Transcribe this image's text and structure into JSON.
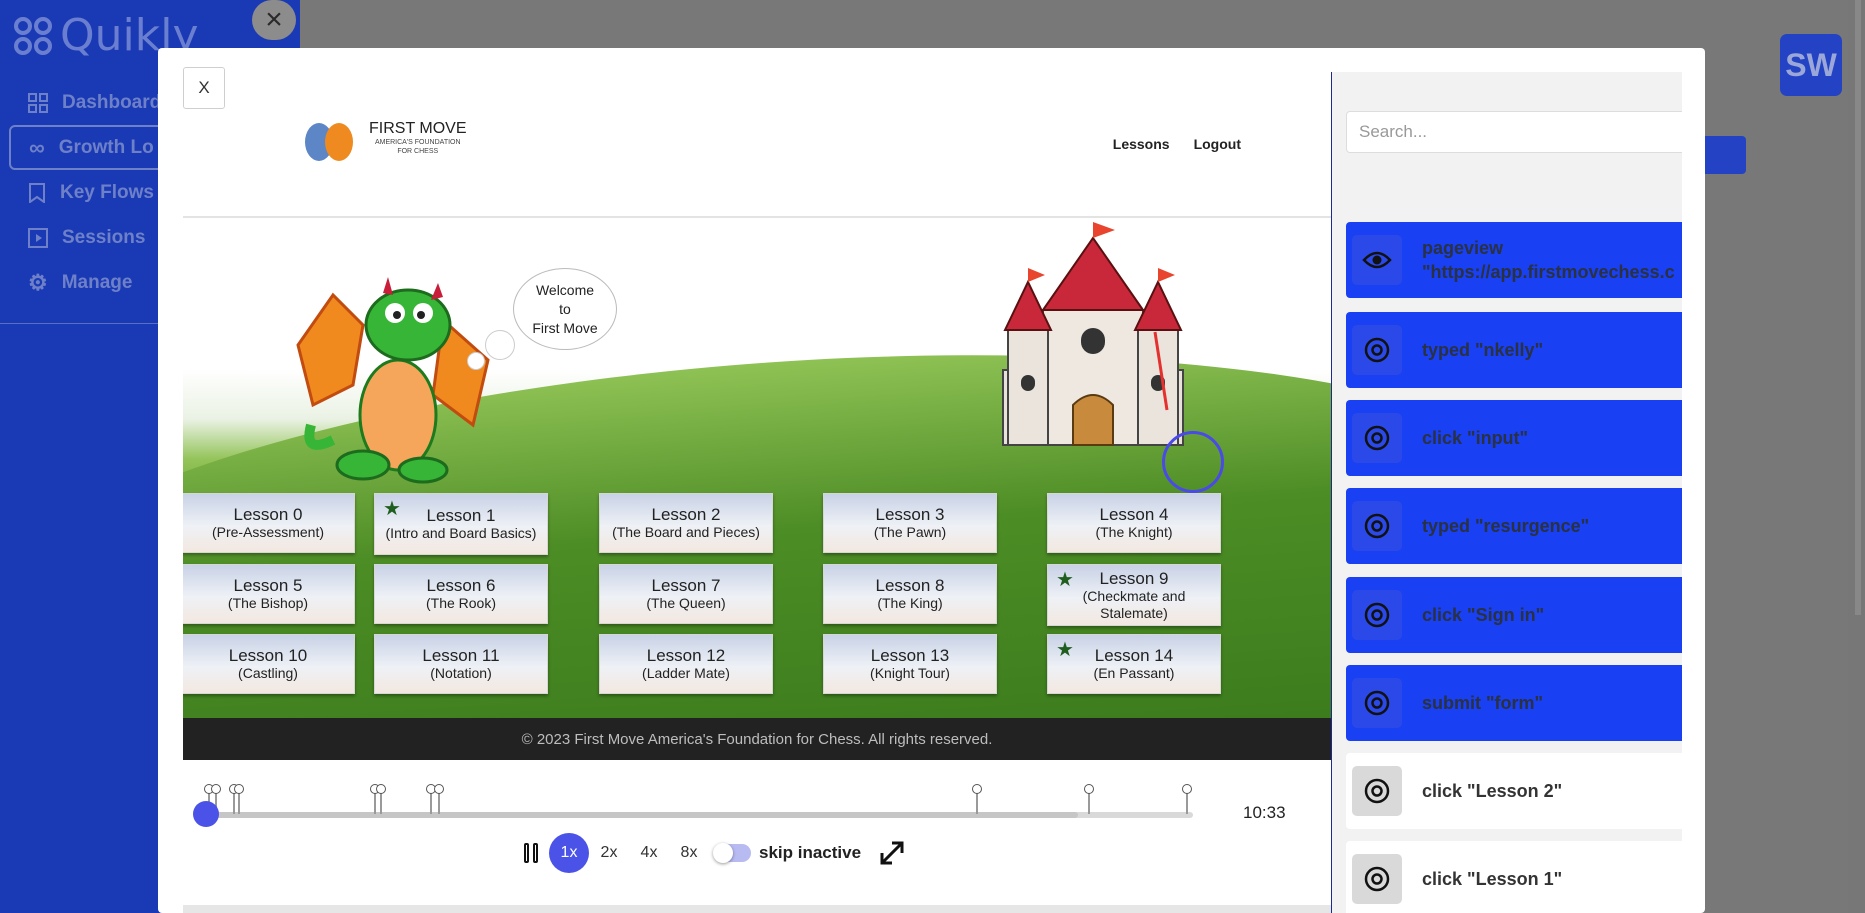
{
  "app": {
    "logo_text": "Quikly",
    "nav": [
      {
        "label": "Dashboard",
        "icon": "grid-icon"
      },
      {
        "label": "Growth Lo",
        "icon": "infinity-icon",
        "active": true
      },
      {
        "label": "Key Flows",
        "icon": "bookmark-icon"
      },
      {
        "label": "Sessions",
        "icon": "play-square-icon"
      },
      {
        "label": "Manage",
        "icon": "gear-icon"
      }
    ],
    "avatar": "SW",
    "top_close": "×"
  },
  "modal": {
    "close_label": "X"
  },
  "site": {
    "logo_title": "FIRST MOVE",
    "logo_sub_1": "AMERICA'S FOUNDATION",
    "logo_sub_2": "FOR CHESS",
    "nav": [
      "Lessons",
      "Logout"
    ],
    "bubble_1": "Welcome",
    "bubble_2": "to",
    "bubble_3": "First Move",
    "footer": "© 2023 First Move America's Foundation for Chess. All rights reserved.",
    "lessons": [
      {
        "name": "Lesson 0",
        "sub": "(Pre-Assessment)",
        "star": false
      },
      {
        "name": "Lesson 1",
        "sub": "(Intro and Board Basics)",
        "star": true
      },
      {
        "name": "Lesson 2",
        "sub": "(The Board and Pieces)",
        "star": false
      },
      {
        "name": "Lesson 3",
        "sub": "(The Pawn)",
        "star": false
      },
      {
        "name": "Lesson 4",
        "sub": "(The Knight)",
        "star": false
      },
      {
        "name": "Lesson 5",
        "sub": "(The Bishop)",
        "star": false
      },
      {
        "name": "Lesson 6",
        "sub": "(The Rook)",
        "star": false
      },
      {
        "name": "Lesson 7",
        "sub": "(The Queen)",
        "star": false
      },
      {
        "name": "Lesson 8",
        "sub": "(The King)",
        "star": false
      },
      {
        "name": "Lesson 9",
        "sub": "(Checkmate and Stalemate)",
        "star": true
      },
      {
        "name": "Lesson 10",
        "sub": "(Castling)",
        "star": false
      },
      {
        "name": "Lesson 11",
        "sub": "(Notation)",
        "star": false
      },
      {
        "name": "Lesson 12",
        "sub": "(Ladder Mate)",
        "star": false
      },
      {
        "name": "Lesson 13",
        "sub": "(Knight Tour)",
        "star": false
      },
      {
        "name": "Lesson 14",
        "sub": "(En Passant)",
        "star": true
      }
    ]
  },
  "player": {
    "total_time": "10:33",
    "progress": 0.02,
    "speeds": [
      "1x",
      "2x",
      "4x",
      "8x"
    ],
    "active_speed": "1x",
    "skip_label": "skip inactive",
    "skip_enabled": false
  },
  "panel": {
    "search_placeholder": "Search...",
    "events": [
      {
        "label": "pageview \"https://app.firstmovechess.c",
        "icon": "eye-icon",
        "highlighted": true
      },
      {
        "label": "typed \"nkelly\"",
        "icon": "target-icon",
        "highlighted": true
      },
      {
        "label": "click \"input\"",
        "icon": "target-icon",
        "highlighted": true
      },
      {
        "label": "typed \"resurgence\"",
        "icon": "target-icon",
        "highlighted": true
      },
      {
        "label": "click \"Sign in\"",
        "icon": "target-icon",
        "highlighted": true
      },
      {
        "label": "submit \"form\"",
        "icon": "target-icon",
        "highlighted": true
      },
      {
        "label": "click \"Lesson 2\"",
        "icon": "target-icon",
        "highlighted": false
      },
      {
        "label": "click \"Lesson 1\"",
        "icon": "target-icon",
        "highlighted": false
      }
    ]
  },
  "colors": {
    "sidebar": "#1a3ab5",
    "accent": "#4a52e8",
    "event_highlight": "#1940f2"
  }
}
